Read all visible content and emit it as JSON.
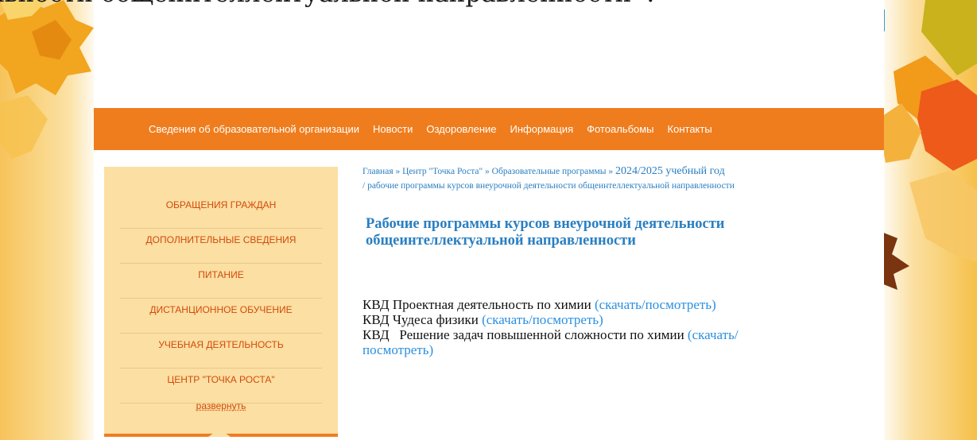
{
  "caption": {
    "text": "льности общеинтеллектуальной направленности»."
  },
  "nav": {
    "items": [
      "Сведения об образовательной организации",
      "Новости",
      "Оздоровление",
      "Информация",
      "Фотоальбомы",
      "Контакты"
    ]
  },
  "sidebar": {
    "items": [
      "ОБРАЩЕНИЯ ГРАЖДАН",
      "ДОПОЛНИТЕЛЬНЫЕ СВЕДЕНИЯ",
      "ПИТАНИЕ",
      "ДИСТАНЦИОННОЕ ОБУЧЕНИЕ",
      "УЧЕБНАЯ ДЕЯТЕЛЬНОСТЬ",
      "ЦЕНТР \"ТОЧКА РОСТА\""
    ],
    "expand_label": "развернуть"
  },
  "breadcrumb": {
    "home": "Главная",
    "sep": " » ",
    "center": "Центр \"Точка Роста\"",
    "programs": "Образовательные программы",
    "year": "2024/2025 учебный год",
    "current": "/ рабочие программы курсов внеурочной деятельности общеинтеллектуальной направленности"
  },
  "main": {
    "title": "Рабочие программы курсов внеурочной деятельности общеинтеллектуальной направленности",
    "documents": [
      {
        "text": "КВД Проектная деятельность по химии ",
        "link": "(скачать/посмотреть)"
      },
      {
        "text": "КВД Чудеса физики ",
        "link": "(скачать/посмотреть)"
      },
      {
        "text": "КВД   Решение задач повышенной сложности по химии ",
        "link": "(скачать/посмотреть)"
      }
    ]
  },
  "colors": {
    "nav_bg": "#ef7d1e",
    "sidebar_bg": "#fbdfa3",
    "sidebar_text": "#d44a0a",
    "link": "#2a8fe0",
    "title": "#2a7fc1",
    "accent_triangle": "#3d9ac9"
  },
  "icons": {
    "left_decor": "autumn-leaves-icon",
    "right_decor": "autumn-leaves-icon",
    "corner": "corner-triangle-icon"
  }
}
